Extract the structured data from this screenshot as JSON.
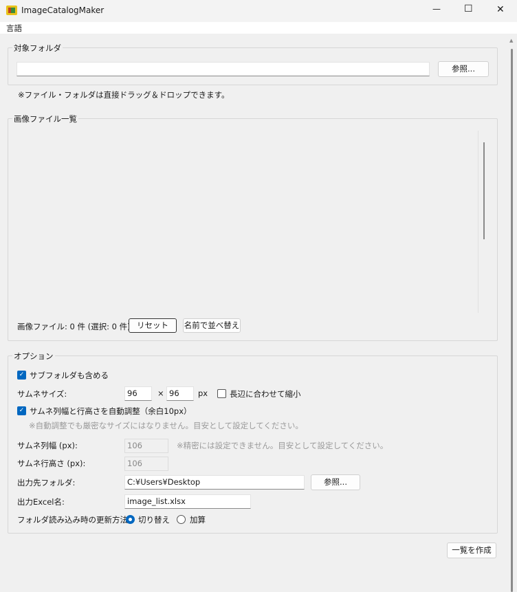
{
  "window": {
    "title": "ImageCatalogMaker",
    "minimize": "—",
    "maximize": "☐",
    "close": "✕"
  },
  "menu": {
    "items": [
      {
        "label": "言語"
      }
    ]
  },
  "target_folder": {
    "title": "対象フォルダ",
    "path_value": "",
    "browse_label": "参照...",
    "note": "※ファイル・フォルダは直接ドラッグ＆ドロップできます。"
  },
  "file_list": {
    "title": "画像ファイル一覧",
    "status": "画像ファイル: 0 件 (選択: 0 件)",
    "reset_label": "リセット",
    "sort_label": "名前で並べ替え"
  },
  "options": {
    "title": "オプション",
    "include_subfolders": {
      "label": "サブフォルダも含める",
      "checked": true
    },
    "thumb_size": {
      "label": "サムネサイズ:",
      "width": "96",
      "times": "×",
      "height": "96",
      "unit": "px",
      "fit_long_side": {
        "label": "長辺に合わせて縮小",
        "checked": false
      }
    },
    "auto_adjust": {
      "label": "サムネ列幅と行高さを自動調整（余白10px）",
      "checked": true,
      "note": "※自動調整でも厳密なサイズにはなりません。目安として設定してください。"
    },
    "col_width": {
      "label": "サムネ列幅 (px):",
      "value": "106",
      "note": "※精密には設定できません。目安として設定してください。"
    },
    "row_height": {
      "label": "サムネ行高さ (px):",
      "value": "106"
    },
    "output_folder": {
      "label": "出力先フォルダ:",
      "value": "C:¥Users¥Desktop",
      "browse_label": "参照..."
    },
    "excel_name": {
      "label": "出力Excel名:",
      "value": "image_list.xlsx"
    },
    "update_mode": {
      "label": "フォルダ読み込み時の更新方法:",
      "options": [
        {
          "label": "切り替え",
          "selected": true
        },
        {
          "label": "加算",
          "selected": false
        }
      ]
    }
  },
  "create_label": "一覧を作成"
}
